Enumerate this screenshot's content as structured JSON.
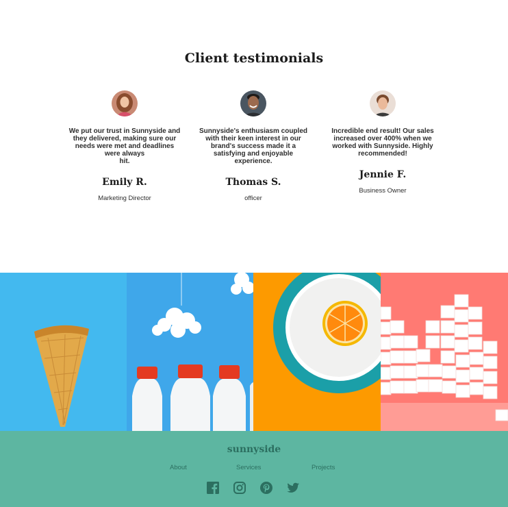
{
  "testimonials": {
    "title": "Client testimonials",
    "items": [
      {
        "avatar_icon": "woman-curly-hair-avatar",
        "quote": "We put our trust in  Sunnyside and they delivered, making sure our needs were met and deadlines were always\nhit.",
        "name": "Emily R.",
        "role": "Marketing Director"
      },
      {
        "avatar_icon": "man-smiling-avatar",
        "quote": "Sunnyside's enthusiasm coupled with their keen interest in our brand's success made it a satisfying and enjoyable experience.",
        "name": "Thomas S.",
        "role": "officer"
      },
      {
        "avatar_icon": "woman-hair-bun-avatar",
        "quote": "Incredible end result! Our sales increased over 400% when we worked with Sunnyside. Highly recommended!",
        "name": "Jennie F.",
        "role": "Business Owner"
      }
    ]
  },
  "gallery": {
    "images": [
      {
        "name": "waffle-cone-on-blue",
        "color": "#43b9ef"
      },
      {
        "name": "milk-bottles-and-cloud",
        "color": "#3fa7ea"
      },
      {
        "name": "orange-on-plate",
        "color": "#fd9a00"
      },
      {
        "name": "sugar-cubes-on-pink",
        "color": "#ff7a73"
      }
    ]
  },
  "footer": {
    "brand": "sunnyside",
    "links": [
      "About",
      "Services",
      "Projects"
    ],
    "social_icons": [
      "facebook-icon",
      "instagram-icon",
      "pinterest-icon",
      "twitter-icon"
    ],
    "background": "#5db6a1",
    "text_color": "#2c6f60"
  }
}
